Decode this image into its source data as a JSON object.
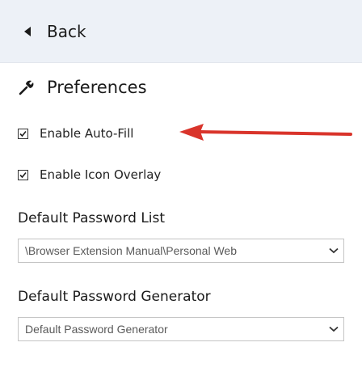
{
  "header": {
    "back_label": "Back"
  },
  "preferences": {
    "title": "Preferences",
    "enable_autofill": {
      "label": "Enable Auto-Fill",
      "checked": true
    },
    "enable_icon_overlay": {
      "label": "Enable Icon Overlay",
      "checked": true
    }
  },
  "default_password_list": {
    "label": "Default Password List",
    "selected": "\\Browser Extension Manual\\Personal Web"
  },
  "default_password_generator": {
    "label": "Default Password Generator",
    "selected": "Default Password Generator"
  },
  "colors": {
    "header_bg": "#edf1f7",
    "annotation_arrow": "#d9342b"
  }
}
